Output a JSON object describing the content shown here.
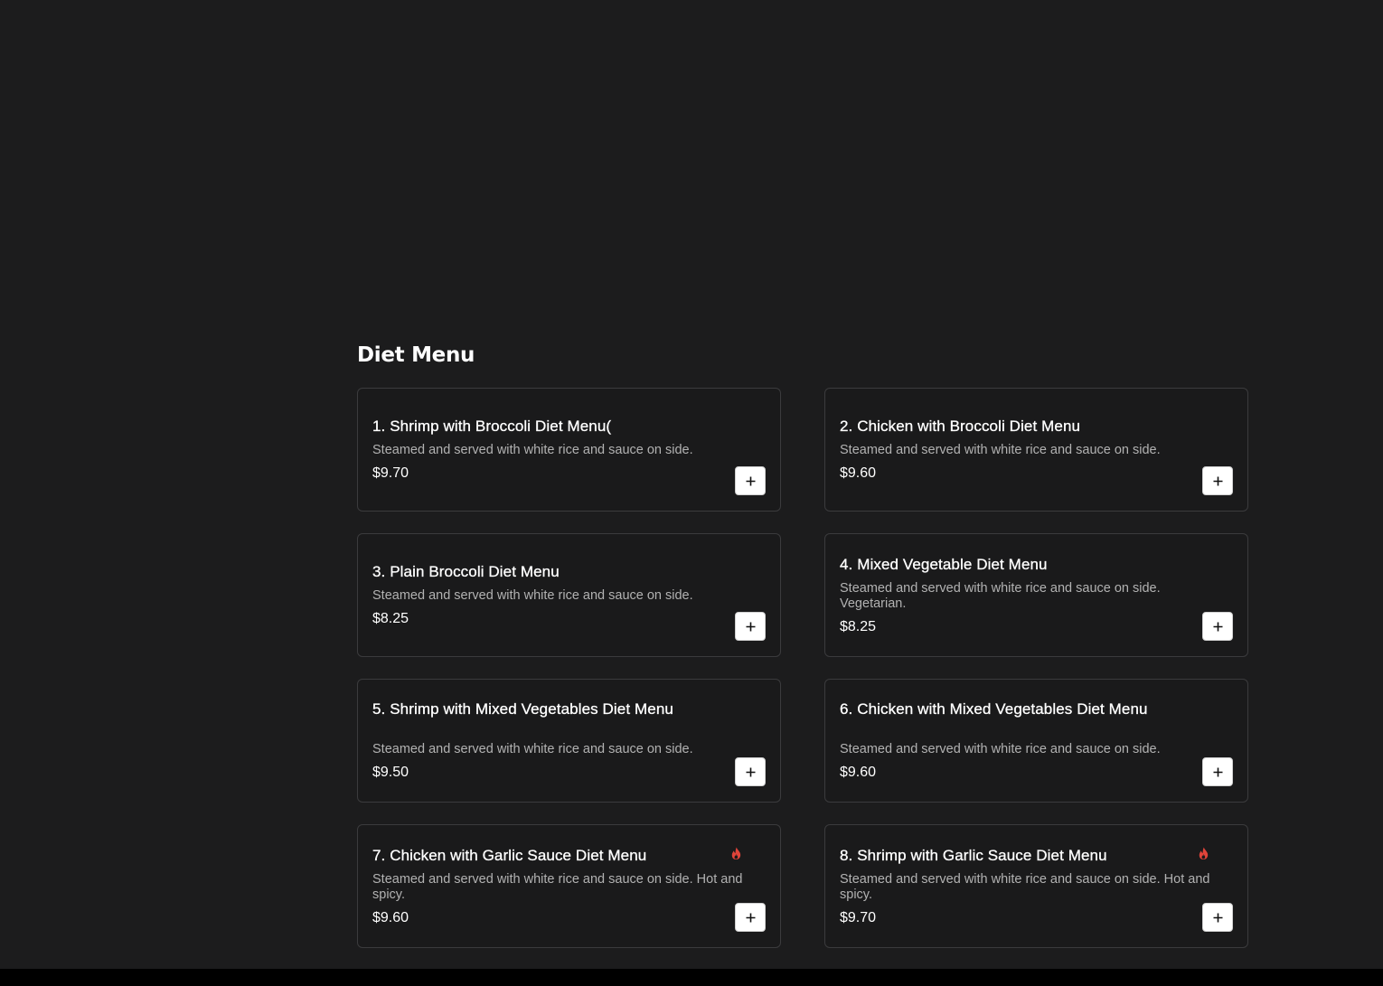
{
  "section": {
    "title": "Diet Menu"
  },
  "colors": {
    "background": "#1c1c1d",
    "card_border": "#3b3b3d",
    "spicy": "#e0443a",
    "button_bg": "#ffffff"
  },
  "items": [
    {
      "name": "1. Shrimp with Broccoli Diet Menu(",
      "description": "Steamed and served with white rice and sauce on side.",
      "price": "$9.70",
      "spicy": false,
      "add_icon": "plus-icon"
    },
    {
      "name": "2. Chicken with Broccoli Diet Menu",
      "description": "Steamed and served with white rice and sauce on side.",
      "price": "$9.60",
      "spicy": false,
      "add_icon": "plus-icon"
    },
    {
      "name": "3. Plain Broccoli Diet Menu",
      "description": "Steamed and served with white rice and sauce on side.",
      "price": "$8.25",
      "spicy": false,
      "add_icon": "plus-icon"
    },
    {
      "name": "4. Mixed Vegetable Diet Menu",
      "description": "Steamed and served with white rice and sauce on side. Vegetarian.",
      "price": "$8.25",
      "spicy": false,
      "add_icon": "plus-icon"
    },
    {
      "name": "5. Shrimp with Mixed Vegetables Diet Menu",
      "description": "Steamed and served with white rice and sauce on side.",
      "price": "$9.50",
      "spicy": false,
      "add_icon": "plus-icon"
    },
    {
      "name": "6. Chicken with Mixed Vegetables Diet Menu",
      "description": "Steamed and served with white rice and sauce on side.",
      "price": "$9.60",
      "spicy": false,
      "add_icon": "plus-icon"
    },
    {
      "name": "7. Chicken with Garlic Sauce Diet Menu",
      "description": "Steamed and served with white rice and sauce on side. Hot and spicy.",
      "price": "$9.60",
      "spicy": true,
      "spicy_icon": "flame-icon",
      "add_icon": "plus-icon"
    },
    {
      "name": "8. Shrimp with Garlic Sauce Diet Menu",
      "description": "Steamed and served with white rice and sauce on side. Hot and spicy.",
      "price": "$9.70",
      "spicy": true,
      "spicy_icon": "flame-icon",
      "add_icon": "plus-icon"
    }
  ]
}
